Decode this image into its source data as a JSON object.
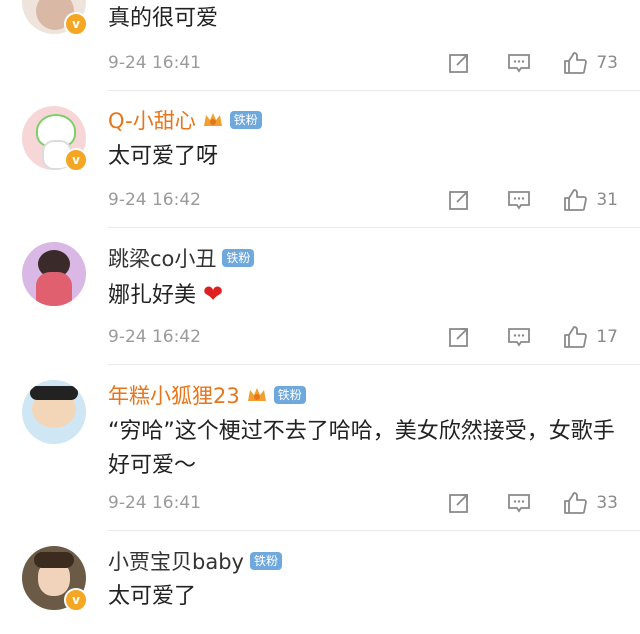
{
  "comments": [
    {
      "name": "",
      "text": "真的很可爱",
      "time": "9-24 16:41",
      "likes": "73",
      "avatar_color": "#efe4dc"
    },
    {
      "name": "Q-小甜心",
      "fan_badge": "铁粉",
      "text": "太可爱了呀",
      "time": "9-24 16:42",
      "likes": "31",
      "avatar_color": "#f6d6d6"
    },
    {
      "name": "跳梁co小丑",
      "fan_badge": "铁粉",
      "text": "娜扎好美",
      "time": "9-24 16:42",
      "likes": "17",
      "avatar_color": "#d9b8e6"
    },
    {
      "name": "年糕小狐狸23",
      "fan_badge": "铁粉",
      "text": "“穷哈”这个梗过不去了哈哈，美女欣然接受，女歌手好可爱～",
      "time": "9-24 16:41",
      "likes": "33",
      "avatar_color": "#cfe6f5"
    },
    {
      "name": "小贾宝贝baby",
      "fan_badge": "铁粉",
      "text": "太可爱了",
      "avatar_color": "#6b5a45"
    }
  ],
  "colors": {
    "vip_name": "#e8751a",
    "fan_badge": "#6fa8dc",
    "verified": "#f5a623"
  }
}
